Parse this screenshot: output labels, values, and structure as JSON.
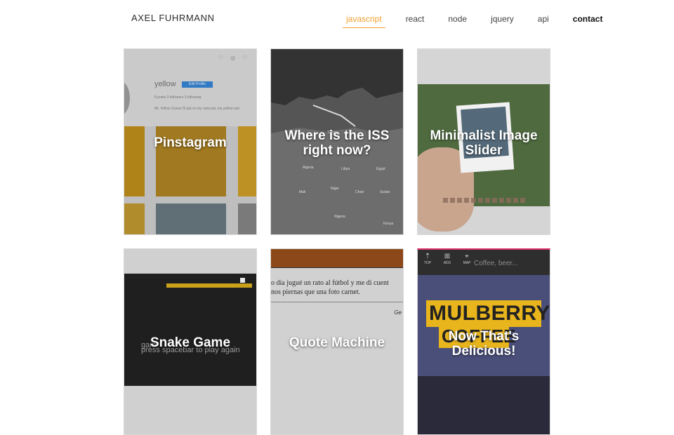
{
  "header": {
    "brand": "AXEL FUHRMANN",
    "nav": [
      {
        "label": "javascript",
        "active": true
      },
      {
        "label": "react"
      },
      {
        "label": "node"
      },
      {
        "label": "jquery"
      },
      {
        "label": "api"
      },
      {
        "label": "contact"
      }
    ]
  },
  "colors": {
    "accent": "#f0a030"
  },
  "projects": [
    {
      "title": "Pinstagram",
      "preview": {
        "username": "yellow",
        "button": "Edit Profile",
        "stats": "8 posts     3 followers     3 following",
        "bio": "Mr. Yellow  Guess I'll put on my raincoat, my yellow rain"
      }
    },
    {
      "title": "Where is the ISS right now?",
      "preview": {
        "labels": [
          "Algeria",
          "Libya",
          "Egypt",
          "Niger",
          "Chad",
          "Mali",
          "Sudan",
          "Nigeria",
          "Kenya",
          "Tunisia"
        ]
      }
    },
    {
      "title": "Minimalist Image Slider"
    },
    {
      "title": "Snake Game",
      "preview": {
        "hint": "press spacebar to play again",
        "hint_top": "gam"
      }
    },
    {
      "title": "Quote Machine",
      "preview": {
        "quote_line1": "o día jugué un rato al fútbol y me di cuent",
        "quote_line2": "nos piernas que una foto carnet.",
        "author": "Ge"
      }
    },
    {
      "title": "Now That's Delicious!",
      "preview": {
        "icons": [
          {
            "glyph": "⇡",
            "label": "TOP"
          },
          {
            "glyph": "⊞",
            "label": "ADD"
          },
          {
            "glyph": "⌖",
            "label": "MAP"
          }
        ],
        "search_placeholder": "Coffee, beer...",
        "sign_line1": "MULBERRY",
        "sign_line2": "COFFEE"
      }
    }
  ]
}
